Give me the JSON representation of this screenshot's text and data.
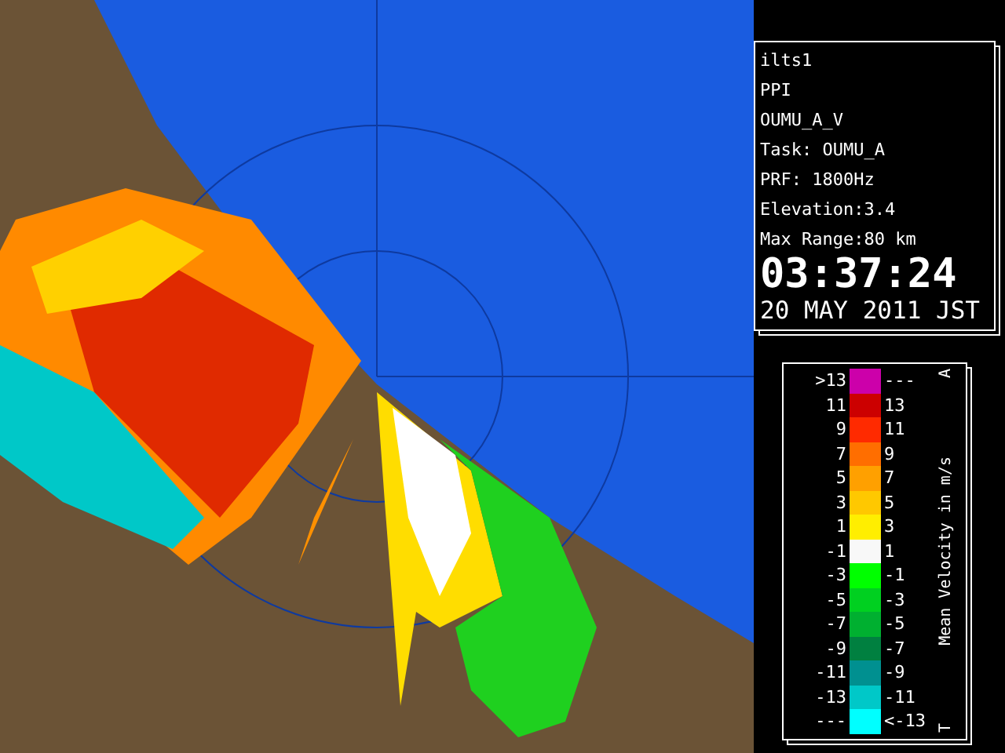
{
  "info": {
    "lines": [
      "ilts1",
      "PPI",
      "OUMU_A_V",
      "Task: OUMU_A",
      "PRF: 1800Hz",
      "Elevation:3.4",
      "Max Range:80 km"
    ],
    "time": "03:37:24",
    "date": "20 MAY 2011 JST"
  },
  "legend": {
    "title": "Mean Velocity in m/s",
    "top_mark": "A",
    "bottom_mark": "T",
    "rows": [
      {
        "low": ">13",
        "high": "---",
        "color": "#cc00aa"
      },
      {
        "low": "11",
        "high": "13",
        "color": "#cc0000"
      },
      {
        "low": "9",
        "high": "11",
        "color": "#ff2a00"
      },
      {
        "low": "7",
        "high": "9",
        "color": "#ff6e00"
      },
      {
        "low": "5",
        "high": "7",
        "color": "#ffa000"
      },
      {
        "low": "3",
        "high": "5",
        "color": "#ffc800"
      },
      {
        "low": "1",
        "high": "3",
        "color": "#ffee00"
      },
      {
        "low": "-1",
        "high": "1",
        "color": "#f8f8f8"
      },
      {
        "low": "-3",
        "high": "-1",
        "color": "#00ff00"
      },
      {
        "low": "-5",
        "high": "-3",
        "color": "#00d020"
      },
      {
        "low": "-7",
        "high": "-5",
        "color": "#00b030"
      },
      {
        "low": "-9",
        "high": "-7",
        "color": "#008040"
      },
      {
        "low": "-11",
        "high": "-9",
        "color": "#009090"
      },
      {
        "low": "-13",
        "high": "-11",
        "color": "#00c8c8"
      },
      {
        "low": "---",
        "high": "<-13",
        "color": "#00ffff"
      }
    ]
  }
}
